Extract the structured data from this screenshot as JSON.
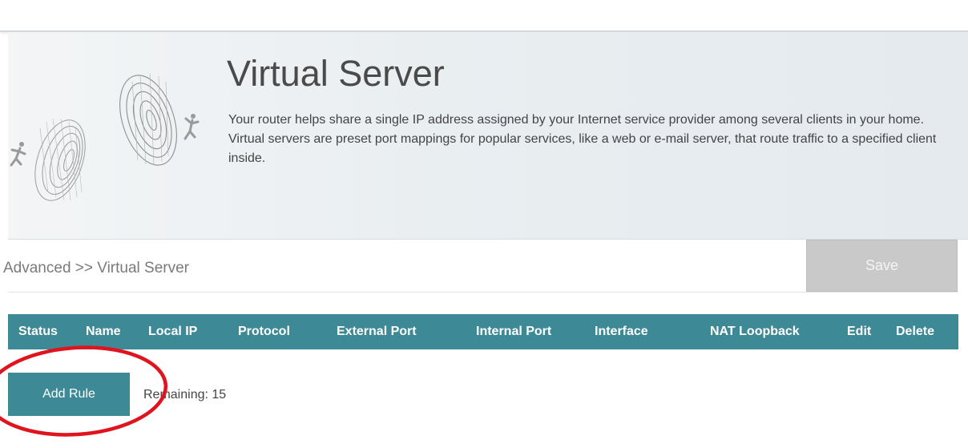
{
  "header": {
    "title": "Virtual Server",
    "description": "Your router helps share a single IP address assigned by your Internet service provider among several clients in your home. Virtual servers are preset port mappings for popular services, like a web or e-mail server, that route traffic to a specified client inside."
  },
  "breadcrumb": "Advanced >> Virtual Server",
  "toolbar": {
    "save_label": "Save"
  },
  "table": {
    "columns": [
      "Status",
      "Name",
      "Local IP",
      "Protocol",
      "External Port",
      "Internal Port",
      "Interface",
      "NAT Loopback",
      "Edit",
      "Delete"
    ]
  },
  "actions": {
    "add_rule_label": "Add Rule",
    "remaining_text": "Remaining: 15"
  },
  "colors": {
    "accent": "#3d8a96",
    "save_disabled": "#c9c9c9",
    "annotation": "#e0141e"
  },
  "icons": [
    "tunnel-illustration",
    "running-person-icon"
  ]
}
